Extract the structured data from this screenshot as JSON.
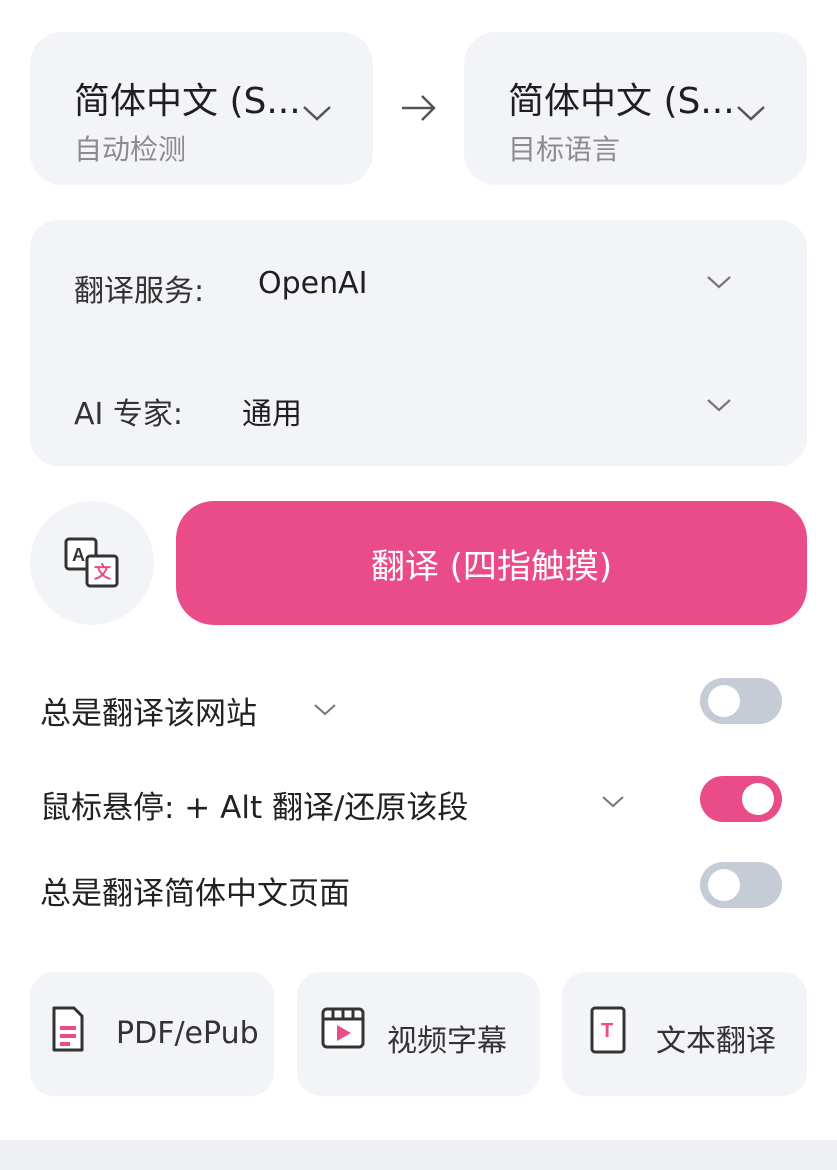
{
  "language": {
    "source_label": "简体中文 (S...",
    "source_sub": "自动检测",
    "target_label": "简体中文 (S...",
    "target_sub": "目标语言"
  },
  "settings": {
    "service_label": "翻译服务:",
    "service_value": "OpenAI",
    "expert_label": "AI 专家:",
    "expert_value": "通用"
  },
  "translate_button": "翻译 (四指触摸)",
  "options": [
    {
      "label": "总是翻译该网站",
      "has_dropdown": true,
      "enabled": false
    },
    {
      "label": "鼠标悬停: + Alt 翻译/还原该段",
      "has_dropdown": true,
      "enabled": true
    },
    {
      "label": "总是翻译简体中文页面",
      "has_dropdown": false,
      "enabled": false
    }
  ],
  "tools": [
    {
      "label": "PDF/ePub",
      "icon": "document-icon"
    },
    {
      "label": "视频字幕",
      "icon": "video-subtitle-icon"
    },
    {
      "label": "文本翻译",
      "icon": "text-translate-icon"
    }
  ],
  "colors": {
    "accent": "#ea4c89",
    "toggle_off": "#c5ccd6",
    "card_bg": "#f3f4f7"
  }
}
